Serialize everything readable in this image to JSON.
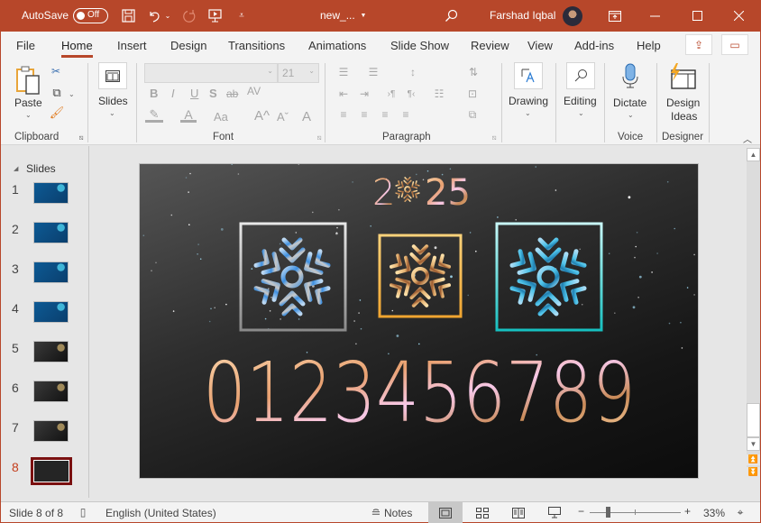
{
  "titlebar": {
    "autosave_label": "AutoSave",
    "autosave_state": "Off",
    "filename": "new_...",
    "user_name": "Farshad Iqbal",
    "icons": [
      "save-icon",
      "undo-icon",
      "redo-icon",
      "present-icon",
      "customize-qat-icon",
      "search-icon",
      "ribbon-display-icon",
      "minimize-icon",
      "maximize-icon",
      "close-icon"
    ]
  },
  "tabs": [
    "File",
    "Home",
    "Insert",
    "Design",
    "Transitions",
    "Animations",
    "Slide Show",
    "Review",
    "View",
    "Add-ins",
    "Help"
  ],
  "active_tab": "Home",
  "ribbon": {
    "clipboard": {
      "paste": "Paste",
      "label": "Clipboard"
    },
    "slides": {
      "label": "Slides"
    },
    "font": {
      "font_name": "",
      "font_size": "21",
      "label": "Font",
      "buttons": [
        "B",
        "I",
        "U",
        "S",
        "ab",
        "AV",
        "Aa",
        "A^",
        "Aˇ"
      ]
    },
    "paragraph": {
      "label": "Paragraph"
    },
    "drawing": {
      "label": "Drawing"
    },
    "editing": {
      "label": "Editing"
    },
    "voice": {
      "dictate": "Dictate",
      "label": "Voice"
    },
    "designer": {
      "design_ideas_1": "Design",
      "design_ideas_2": "Ideas",
      "label": "Designer"
    }
  },
  "thumbnails": {
    "header": "Slides",
    "items": [
      {
        "num": "1",
        "theme": "blue"
      },
      {
        "num": "2",
        "theme": "blue"
      },
      {
        "num": "3",
        "theme": "blue"
      },
      {
        "num": "4",
        "theme": "blue"
      },
      {
        "num": "5",
        "theme": "dark"
      },
      {
        "num": "6",
        "theme": "dark"
      },
      {
        "num": "7",
        "theme": "dark"
      },
      {
        "num": "8",
        "theme": "dark",
        "selected": true
      }
    ]
  },
  "slide": {
    "year_left": "2",
    "year_right": "25",
    "digits": "0123456789",
    "snowflake_boxes": [
      {
        "style": "silver-blue",
        "frame_color": "#c8c8c8"
      },
      {
        "style": "gold",
        "frame_color": "#f4b247"
      },
      {
        "style": "cyan",
        "frame_color": "#3fd6d6"
      }
    ]
  },
  "statusbar": {
    "slide_info": "Slide 8 of 8",
    "language": "English (United States)",
    "notes": "Notes",
    "zoom": "33%",
    "zoom_fraction": 0.2
  }
}
